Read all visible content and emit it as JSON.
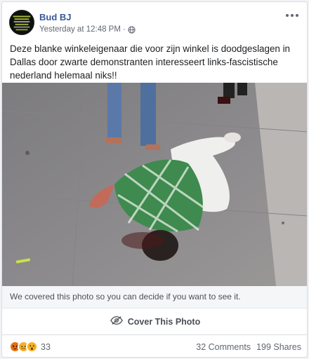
{
  "post": {
    "author": "Bud BJ",
    "timestamp": "Yesterday at 12:48 PM",
    "separator": "·",
    "audience_icon": "globe-icon",
    "text": "Deze blanke winkeleigenaar die voor zijn winkel is doodgeslagen in Dallas door zwarte demonstranten interesseert links-fascistische nederland helemaal niks!!"
  },
  "photo": {
    "cover_notice": "We covered this photo so you can decide if you want to see it.",
    "cover_button_label": "Cover This Photo",
    "cover_button_icon": "eye-slash-icon"
  },
  "footer": {
    "reactions": [
      "angry",
      "sad",
      "wow"
    ],
    "reaction_count": "33",
    "comments": "32 Comments",
    "shares": "199 Shares"
  },
  "colors": {
    "link_blue": "#385898",
    "angry": "#e9710f",
    "sad": "#f7b125",
    "wow": "#f7b125"
  }
}
